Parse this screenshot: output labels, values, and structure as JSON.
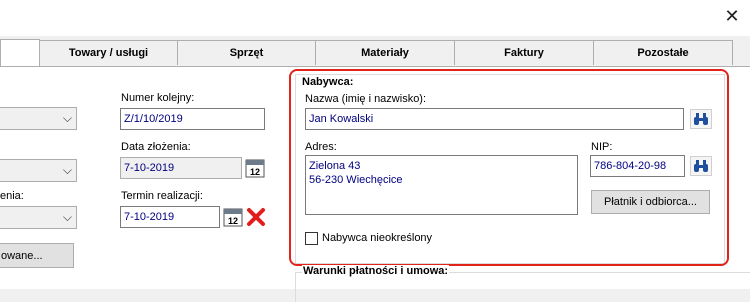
{
  "window": {
    "close_icon": "close-icon"
  },
  "tabs": [
    {
      "label": ""
    },
    {
      "label": "Towary / usługi"
    },
    {
      "label": "Sprzęt"
    },
    {
      "label": "Materiały"
    },
    {
      "label": "Faktury"
    },
    {
      "label": "Pozostałe"
    }
  ],
  "left": {
    "label_enia": "enia:",
    "button_owane": "owane..."
  },
  "order": {
    "number_label": "Numer kolejny:",
    "number_value": "Z/1/10/2019",
    "date_label": "Data złożenia:",
    "date_value": "7-10-2019",
    "deadline_label": "Termin realizacji:",
    "deadline_value": "7-10-2019",
    "calendar_icon_text": "12"
  },
  "buyer": {
    "title": "Nabywca:",
    "name_label": "Nazwa (imię i nazwisko):",
    "name_value": "Jan Kowalski",
    "address_label": "Adres:",
    "address_line1": "Zielona 43",
    "address_line2": "56-230 Wiechęcice",
    "nip_label": "NIP:",
    "nip_value": "786-804-20-98",
    "payer_button": "Płatnik i odbiorca...",
    "undefined_label": "Nabywca nieokreślony",
    "undefined_checked": false
  },
  "terms": {
    "title": "Warunki płatności i umowa:"
  },
  "colors": {
    "highlight": "#e2231a",
    "value_text": "#000080"
  }
}
